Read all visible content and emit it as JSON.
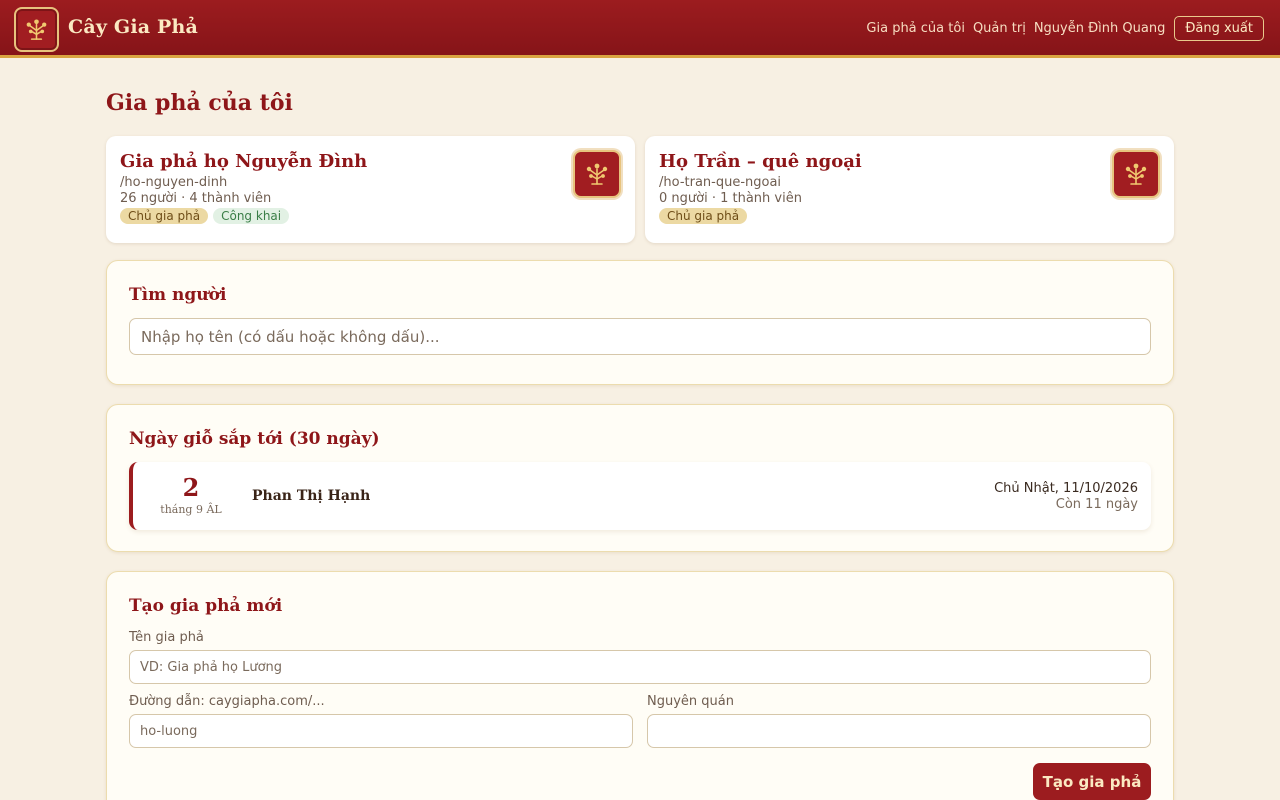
{
  "header": {
    "brand": "Cây Gia Phả",
    "nav": {
      "my_trees": "Gia phả của tôi",
      "admin": "Quản trị",
      "user_name": "Nguyễn Đình Quang",
      "logout": "Đăng xuất"
    },
    "icon": "family-tree-icon"
  },
  "page": {
    "title": "Gia phả của tôi"
  },
  "trees": [
    {
      "name": "Gia phả họ Nguyễn Đình",
      "slug": "/ho-nguyen-dinh",
      "stats": "26 người · 4 thành viên",
      "badges": {
        "owner": "Chủ gia phả",
        "public": "Công khai"
      }
    },
    {
      "name": "Họ Trần – quê ngoại",
      "slug": "/ho-tran-que-ngoai",
      "stats": "0 người · 1 thành viên",
      "badges": {
        "owner": "Chủ gia phả"
      }
    }
  ],
  "search": {
    "title": "Tìm người",
    "placeholder": "Nhập họ tên (có dấu hoặc không dấu)..."
  },
  "anniversaries": {
    "title": "Ngày giỗ sắp tới (30 ngày)",
    "items": [
      {
        "day": "2",
        "month": "tháng 9 ÂL",
        "name": "Phan Thị Hạnh",
        "date": "Chủ Nhật, 11/10/2026",
        "remaining": "Còn 11 ngày"
      }
    ]
  },
  "create": {
    "title": "Tạo gia phả mới",
    "name_label": "Tên gia phả",
    "name_placeholder": "VD: Gia phả họ Lương",
    "slug_label": "Đường dẫn: caygiapha.com/...",
    "slug_placeholder": "ho-luong",
    "origin_label": "Nguyên quán",
    "origin_placeholder": "",
    "submit": "Tạo gia phả"
  },
  "colors": {
    "primary": "#9c1c1f",
    "gold": "#d9a441",
    "background": "#f7f0e3"
  }
}
